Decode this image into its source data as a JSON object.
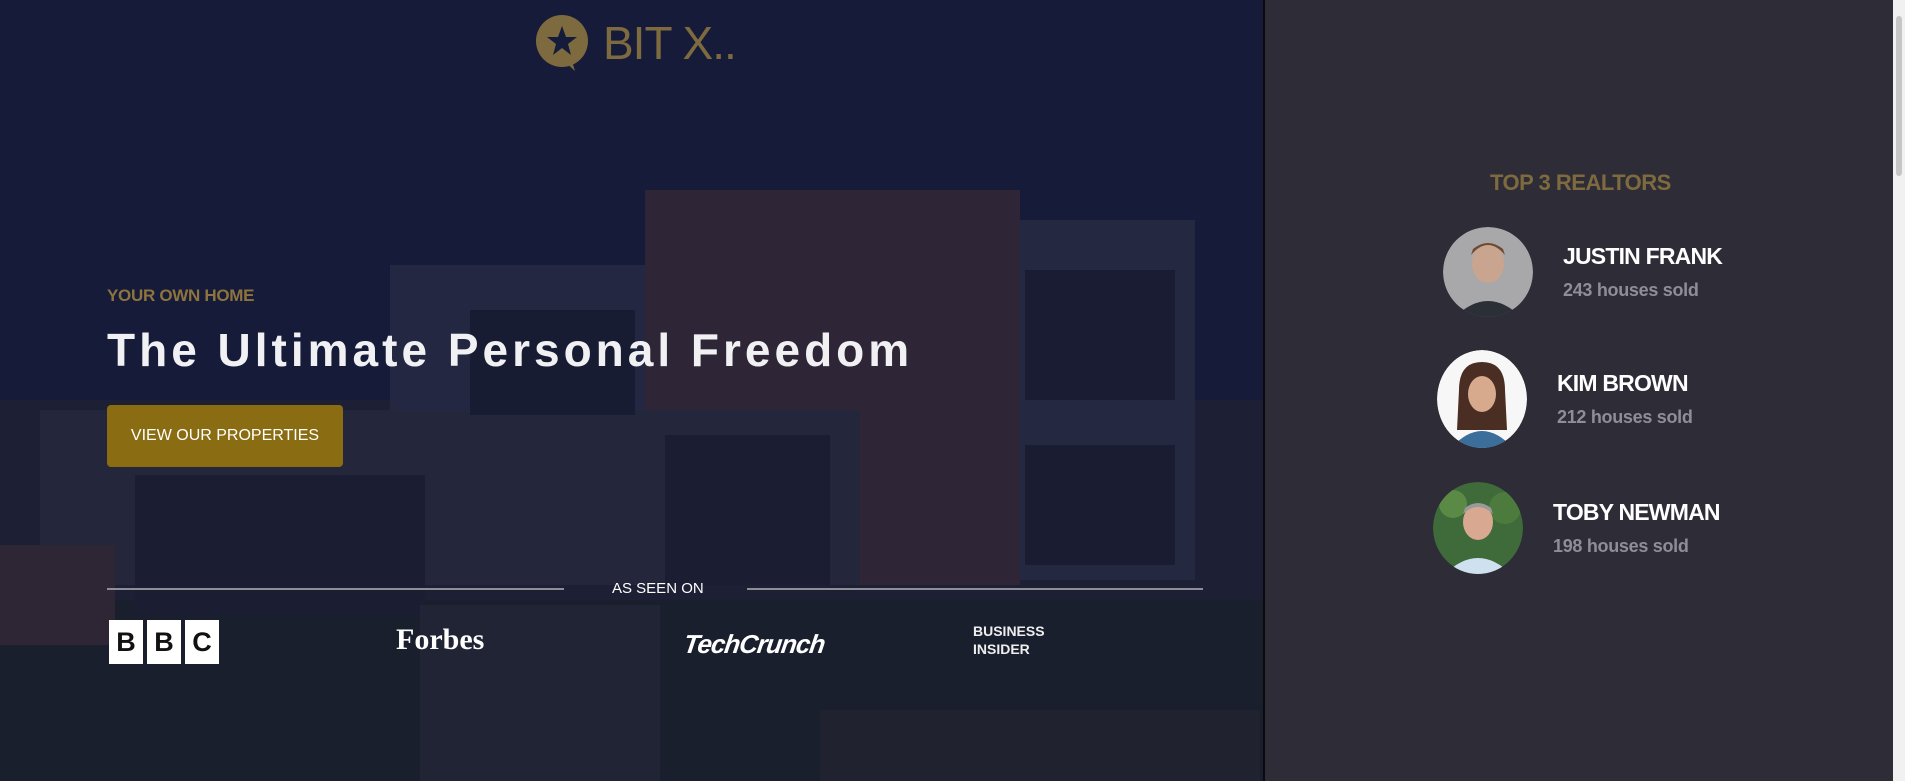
{
  "brand": {
    "name": "BIT X..",
    "icon": "star-chat-bubble-icon",
    "color": "#7e6a3f"
  },
  "hero": {
    "eyebrow": "YOUR OWN HOME",
    "headline": "The Ultimate Personal Freedom",
    "cta_label": "VIEW OUR PROPERTIES",
    "cta_color": "#8a6c12"
  },
  "press": {
    "label": "AS SEEN ON",
    "logos": [
      {
        "name": "BBC",
        "letters": [
          "B",
          "B",
          "C"
        ]
      },
      {
        "name": "Forbes"
      },
      {
        "name": "TechCrunch"
      },
      {
        "name": "BUSINESS INSIDER",
        "line1": "BUSINESS",
        "line2": "INSIDER"
      }
    ]
  },
  "realtors": {
    "title": "TOP 3 REALTORS",
    "items": [
      {
        "name": "JUSTIN FRANK",
        "sold": "243 houses sold"
      },
      {
        "name": "KIM BROWN",
        "sold": "212 houses sold"
      },
      {
        "name": "TOBY NEWMAN",
        "sold": "198 houses sold"
      }
    ]
  }
}
